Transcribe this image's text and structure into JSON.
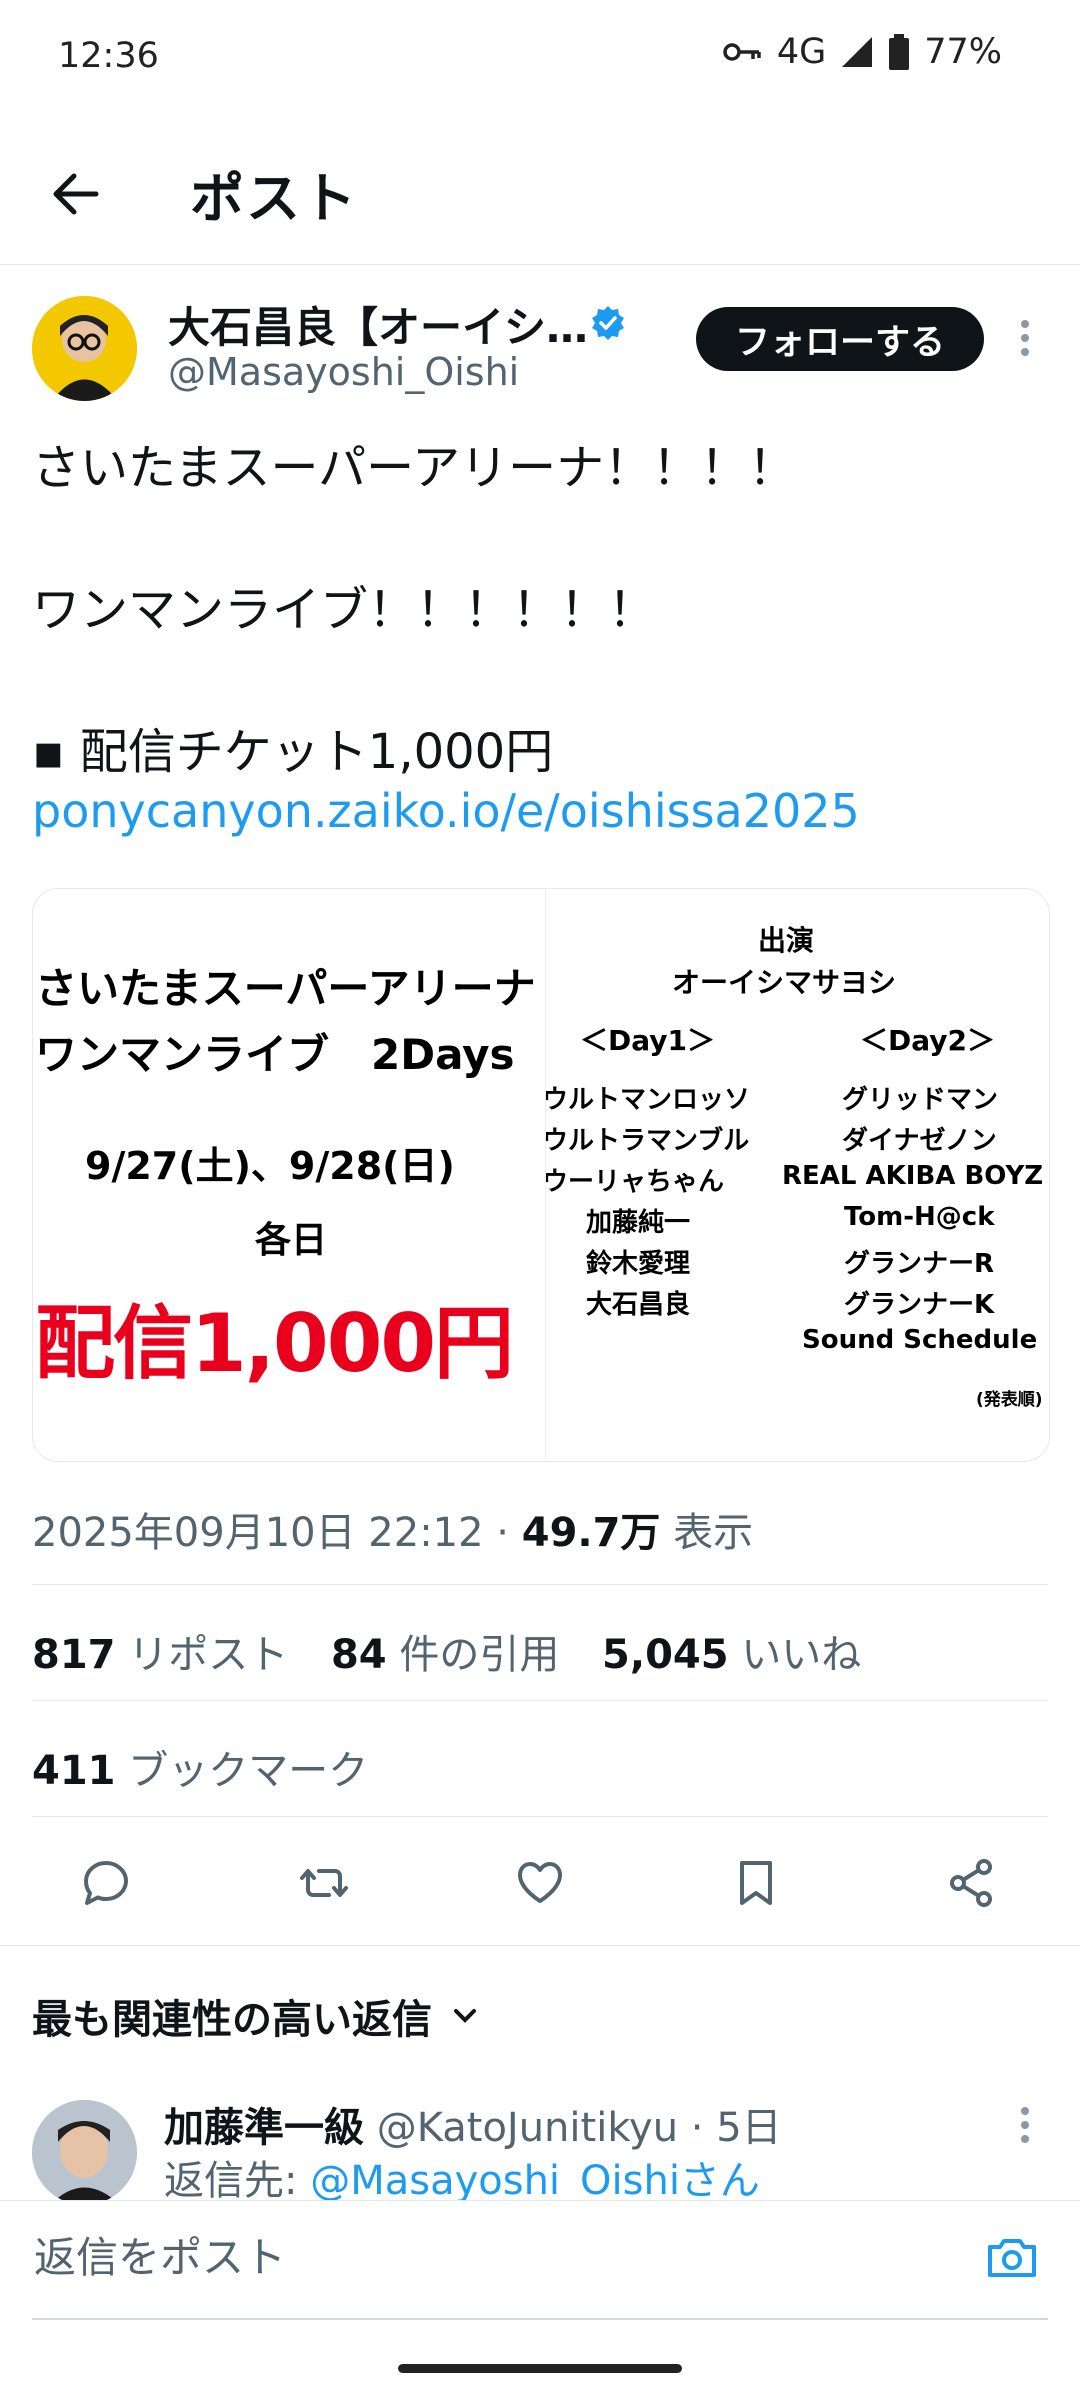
{
  "status": {
    "time": "12:36",
    "network": "4G",
    "battery": "77%"
  },
  "header": {
    "title": "ポスト"
  },
  "author": {
    "name": "大石昌良【オーイシ…",
    "handle": "@Masayoshi_Oishi",
    "follow_label": "フォローする"
  },
  "tweet": {
    "lines": [
      "さいたまスーパーアリーナ！！！！",
      "ワンマンライブ！！！！！！",
      "▪ 配信チケット1,000円"
    ],
    "link": "ponycanyon.zaiko.io/e/oishissa2025"
  },
  "media": {
    "left": {
      "line1": "さいたまスーパーアリーナ",
      "line2": "ワンマンライブ　2Days",
      "dates": "9/27(土)、9/28(日)",
      "each": "各日",
      "price": "配信1,000円"
    },
    "right": {
      "heading": "出演",
      "headliner": "オーイシマサヨシ",
      "day1_label": "＜Day1＞",
      "day2_label": "＜Day2＞",
      "day1": [
        "ウルトマンロッソ",
        "ウルトラマンブル",
        "ウーリャちゃん",
        "加藤純一",
        "鈴木愛理",
        "大石昌良"
      ],
      "day2": [
        "グリッドマン",
        "ダイナゼノン",
        "REAL AKIBA BOYZ",
        "Tom-H@ck",
        "グランナーR",
        "グランナーK",
        "Sound Schedule"
      ],
      "note": "(発表順)"
    }
  },
  "meta": {
    "datetime": "2025年09月10日 22:12 · ",
    "views": "49.7万",
    "views_label": " 表示"
  },
  "stats": {
    "reposts": "817",
    "reposts_label": " リポスト",
    "quotes": "84",
    "quotes_label": " 件の引用",
    "likes": "5,045",
    "likes_label": " いいね",
    "bookmarks": "411",
    "bookmarks_label": " ブックマーク"
  },
  "replies_sort": "最も関連性の高い返信",
  "reply": {
    "name": "加藤準一級",
    "handle": " @KatoJunitikyu · 5日",
    "reply_to_prefix": "返信先: ",
    "reply_to": "@Masayoshi_Oishiさん"
  },
  "compose": {
    "placeholder": "返信をポスト"
  },
  "colors": {
    "accent": "#1d9bf0",
    "follow_bg": "#0f1419",
    "price_red": "#e8001c"
  }
}
